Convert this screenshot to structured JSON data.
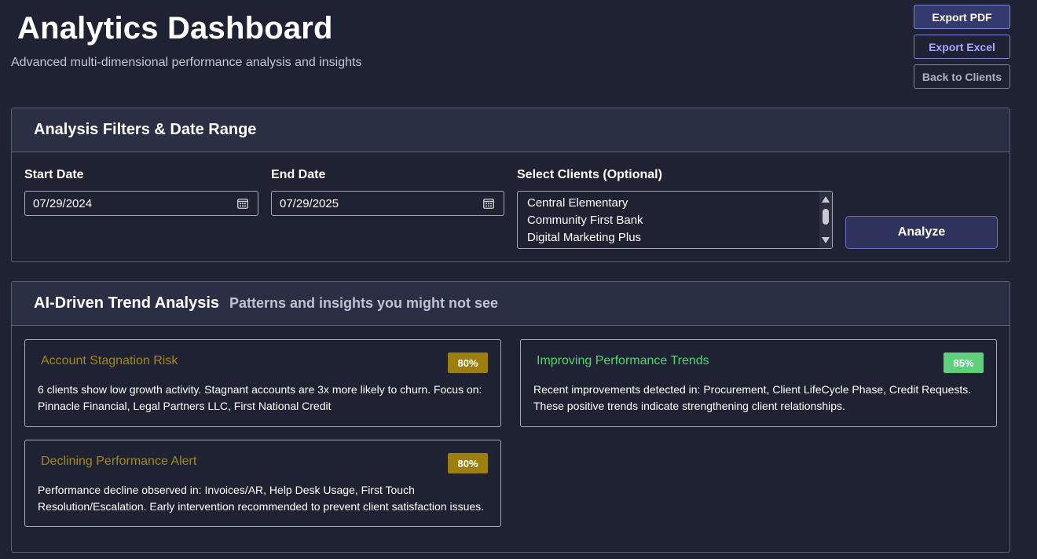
{
  "header": {
    "title": "Analytics Dashboard",
    "subtitle": "Advanced multi-dimensional performance analysis and insights"
  },
  "actions": {
    "export_pdf": "Export PDF",
    "export_excel": "Export Excel",
    "back": "Back to Clients"
  },
  "filters": {
    "title": "Analysis Filters & Date Range",
    "start_label": "Start Date",
    "start_value": "07/29/2024",
    "end_label": "End Date",
    "end_value": "07/29/2025",
    "clients_label": "Select Clients (Optional)",
    "clients": [
      "Central Elementary",
      "Community First Bank",
      "Digital Marketing Plus"
    ],
    "analyze": "Analyze"
  },
  "trends": {
    "title": "AI-Driven Trend Analysis",
    "subtitle": "Patterns and insights you might not see",
    "cards": [
      {
        "title": "Account Stagnation Risk",
        "confidence": "80%",
        "text": "6 clients show low growth activity. Stagnant accounts are 3x more likely to churn. Focus on: Pinnacle Financial, Legal Partners LLC, First National Credit",
        "tone": "warning"
      },
      {
        "title": "Improving Performance Trends",
        "confidence": "85%",
        "text": "Recent improvements detected in: Procurement, Client LifeCycle Phase, Credit Requests. These positive trends indicate strengthening client relationships.",
        "tone": "positive"
      },
      {
        "title": "Declining Performance Alert",
        "confidence": "80%",
        "text": "Performance decline observed in: Invoices/AR, Help Desk Usage, First Touch Resolution/Escalation. Early intervention recommended to prevent client satisfaction issues.",
        "tone": "warning"
      }
    ]
  },
  "colors": {
    "background": "#1e2233",
    "panel_header": "#2a2f44",
    "warning": "#9c800b",
    "positive": "#5bd17a",
    "accent": "#7f84d9"
  }
}
